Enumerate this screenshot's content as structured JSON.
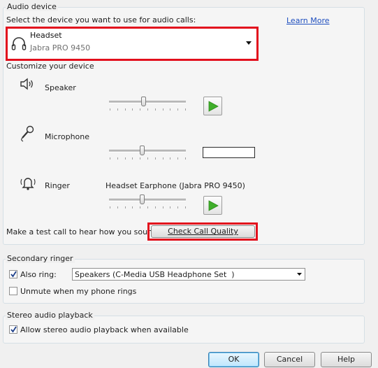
{
  "audio_device": {
    "group_title": "Audio device",
    "select_prompt": "Select the device you want to use for audio calls:",
    "learn_more": "Learn More",
    "device_name": "Headset",
    "device_model": "Jabra PRO 9450",
    "customize_label": "Customize your device",
    "speaker_label": "Speaker",
    "microphone_label": "Microphone",
    "ringer_label": "Ringer",
    "ringer_device": "Headset Earphone (Jabra PRO 9450)",
    "speaker_volume": 0.45,
    "microphone_volume": 0.43,
    "ringer_volume": 0.43,
    "test_call_prompt": "Make a test call to hear how you sound",
    "check_call_quality": "Check Call Quality"
  },
  "secondary_ringer": {
    "group_title": "Secondary ringer",
    "also_ring_label": "Also ring:",
    "also_ring_checked": true,
    "also_ring_value": "Speakers (C-Media USB Headphone Set  )",
    "unmute_label": "Unmute when my phone rings",
    "unmute_checked": false
  },
  "stereo": {
    "group_title": "Stereo audio playback",
    "allow_label": "Allow stereo audio playback when available",
    "allow_checked": true
  },
  "footer": {
    "ok": "OK",
    "cancel": "Cancel",
    "help": "Help"
  },
  "colors": {
    "highlight": "#e2101d",
    "link": "#1f4fbf",
    "play_green": "#3fae2a"
  }
}
